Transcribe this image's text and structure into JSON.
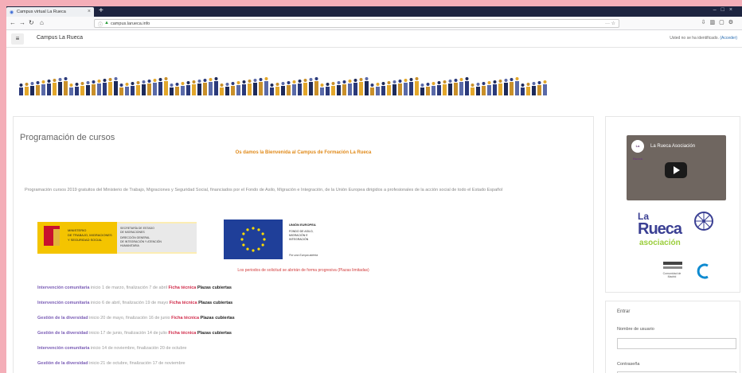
{
  "browser": {
    "tab_title": "Campus virtual La Rueca",
    "new_tab_symbol": "+",
    "url": "campus.larueca.info",
    "colors": {
      "tabbar": "#1d2440",
      "frame_border": "#f4aeb8"
    }
  },
  "navbar": {
    "menu_symbol": "≡",
    "site_name": "Campus La Rueca",
    "login_message": "Usted no se ha identificado.",
    "login_link": "(Acceder)"
  },
  "main": {
    "title": "Programación de cursos",
    "welcome": "Os damos la Bienvenida al Campus de Formación La Rueca",
    "intro": "Programación cursos 2019 gratuitos del Ministerio de Trabajo, Migraciones y Seguridad Social, financiados por el Fondo de Asilo, Migración e Integración, de la Unión Europea dirigidos a profesionales de la acción social de todo el Estado Español",
    "ministerio": {
      "lines_left": [
        "MINISTERIO",
        "DE TRABAJO, MIGRACIONES",
        "Y SEGURIDAD SOCIAL"
      ],
      "lines_right": [
        "SECRETARÍA DE ESTADO",
        "DE MIGRACIONES",
        "DIRECCIÓN GENERAL",
        "DE INTEGRACIÓN Y ATENCIÓN",
        "HUMANITARIA"
      ],
      "colors": {
        "yellow": "#f4c400",
        "red": "#c8102e"
      }
    },
    "eu": {
      "lines": [
        "UNIÓN EUROPEA",
        "FONDO DE ASILO,",
        "MIGRACIÓN E",
        "INTEGRACIÓN"
      ],
      "motto": "Por una Europa abierta",
      "color": "#1f3f99"
    },
    "notice": "Los periodos de solicitud se abrirán de forma progresiva (Plazas limitadas)",
    "courses": [
      {
        "title": "Intervención comunitaria",
        "dates": "inicio 1 de marzo, finalización 7 de abril",
        "ficha": "Ficha técnica",
        "plazas": "Plazas cubiertas"
      },
      {
        "title": "Intervención comunitaria",
        "dates": "inicio 6 de abril, finalización 19 de mayo",
        "ficha": "Ficha técnica",
        "plazas": "Plazas cubiertas"
      },
      {
        "title": "Gestión de la diversidad",
        "dates": "inicio 20 de mayo, finalización 16 de junio",
        "ficha": "Ficha técnica",
        "plazas": "Plazas cubiertas"
      },
      {
        "title": "Gestión de la diversidad",
        "dates": "inicio 17 de junio, finalización 14 de julio",
        "ficha": "Ficha técnica",
        "plazas": "Plazas cubiertas"
      },
      {
        "title": "Intervención comunitaria",
        "dates": "inicio 14 de noviembre, finalización 20 de octubre",
        "ficha": "",
        "plazas": ""
      },
      {
        "title": "Gestión de la diversidad",
        "dates": "inicio 21 de octubre, finalización 17 de noviembre",
        "ficha": "",
        "plazas": ""
      }
    ]
  },
  "sidebar": {
    "video": {
      "title": "La Rueca Asociación",
      "avatar": "La Rueca"
    },
    "logo": {
      "la": "La",
      "name": "Rueca",
      "asociacion": "asociación",
      "colors": {
        "blue": "#3a3f93",
        "green": "#9acd3a"
      }
    },
    "partner_name": "Comunidad de Madrid",
    "login": {
      "title": "Entrar",
      "username_label": "Nombre de usuario",
      "password_label": "Contraseña"
    }
  }
}
